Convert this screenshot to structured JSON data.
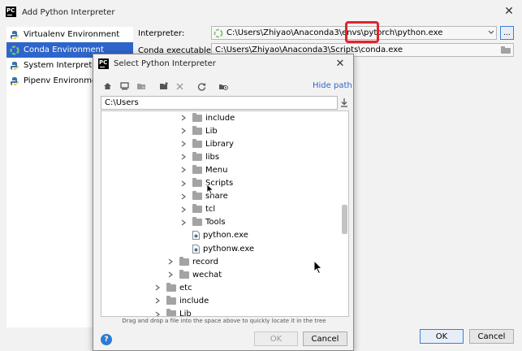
{
  "window": {
    "title": "Add Python Interpreter",
    "logo_text": "PC"
  },
  "sidebar": {
    "items": [
      {
        "label": "Virtualenv Environment",
        "icon": "virtualenv-icon"
      },
      {
        "label": "Conda Environment",
        "icon": "conda-icon"
      },
      {
        "label": "System Interpreter",
        "icon": "python-icon"
      },
      {
        "label": "Pipenv Environment",
        "icon": "pipenv-icon"
      }
    ]
  },
  "form": {
    "interpreter_label": "Interpreter:",
    "interpreter_value": "C:\\Users\\Zhiyao\\Anaconda3\\envs\\pytorch\\python.exe",
    "browse_label": "...",
    "conda_label": "Conda executable:",
    "conda_value": "C:\\Users\\Zhiyao\\Anaconda3\\Scripts\\conda.exe"
  },
  "footer": {
    "ok_label": "OK",
    "cancel_label": "Cancel"
  },
  "dialog": {
    "title": "Select Python Interpreter",
    "logo_text": "PC",
    "hide_path_label": "Hide path",
    "path_value": "C:\\Users",
    "hint": "Drag and drop a file into the space above to quickly locate it in the tree",
    "ok_label": "OK",
    "cancel_label": "Cancel",
    "help_label": "?",
    "toolbar_icons": [
      "home-icon",
      "desktop-icon",
      "project-icon",
      "new-folder-icon",
      "delete-icon",
      "refresh-icon",
      "show-hidden-icon"
    ],
    "tree": [
      {
        "label": "include",
        "type": "folder"
      },
      {
        "label": "Lib",
        "type": "folder"
      },
      {
        "label": "Library",
        "type": "folder"
      },
      {
        "label": "libs",
        "type": "folder"
      },
      {
        "label": "Menu",
        "type": "folder"
      },
      {
        "label": "Scripts",
        "type": "folder"
      },
      {
        "label": "share",
        "type": "folder"
      },
      {
        "label": "tcl",
        "type": "folder"
      },
      {
        "label": "Tools",
        "type": "folder"
      },
      {
        "label": "python.exe",
        "type": "file"
      },
      {
        "label": "pythonw.exe",
        "type": "file"
      },
      {
        "label": "record",
        "type": "folder"
      },
      {
        "label": "wechat",
        "type": "folder"
      },
      {
        "label": "etc",
        "type": "folder"
      },
      {
        "label": "include",
        "type": "folder"
      },
      {
        "label": "Lib",
        "type": "folder"
      }
    ]
  },
  "colors": {
    "selection": "#2f65ca",
    "link": "#2f65ca",
    "highlight_box": "#e0242f"
  }
}
